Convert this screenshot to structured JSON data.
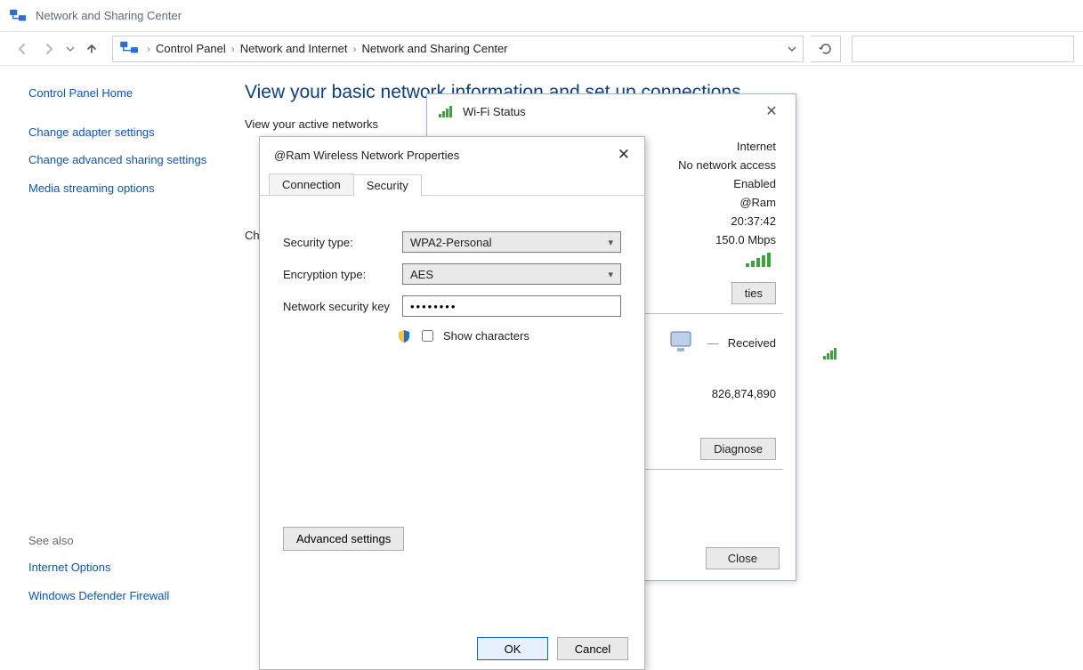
{
  "header": {
    "title": "Network and Sharing Center"
  },
  "nav": {
    "breadcrumbs": [
      "Control Panel",
      "Network and Internet",
      "Network and Sharing Center"
    ]
  },
  "sidebar": {
    "home": "Control Panel Home",
    "links": [
      "Change adapter settings",
      "Change advanced sharing settings",
      "Media streaming options"
    ],
    "see_also_label": "See also",
    "see_also": [
      "Internet Options",
      "Windows Defender Firewall"
    ]
  },
  "main": {
    "heading": "View your basic network information and set up connections",
    "active_networks": "View your active networks",
    "ch_label_prefix": "Ch"
  },
  "wifi_status": {
    "title": "Wi-Fi Status",
    "rows": {
      "internet": "Internet",
      "access": "No network access",
      "state": "Enabled",
      "ssid": "@Ram",
      "duration": "20:37:42",
      "speed": "150.0 Mbps"
    },
    "btn_props_suffix": "ties",
    "activity_received_label": "Received",
    "activity_received": "826,874,890",
    "diagnose": "Diagnose",
    "close": "Close"
  },
  "props": {
    "title": "@Ram Wireless Network Properties",
    "tabs": {
      "connection": "Connection",
      "security": "Security"
    },
    "fields": {
      "sec_type_label": "Security type:",
      "sec_type_value": "WPA2-Personal",
      "enc_type_label": "Encryption type:",
      "enc_type_value": "AES",
      "key_label": "Network security key",
      "key_value": "••••••••",
      "show_chars": "Show characters"
    },
    "advanced": "Advanced settings",
    "ok": "OK",
    "cancel": "Cancel"
  }
}
